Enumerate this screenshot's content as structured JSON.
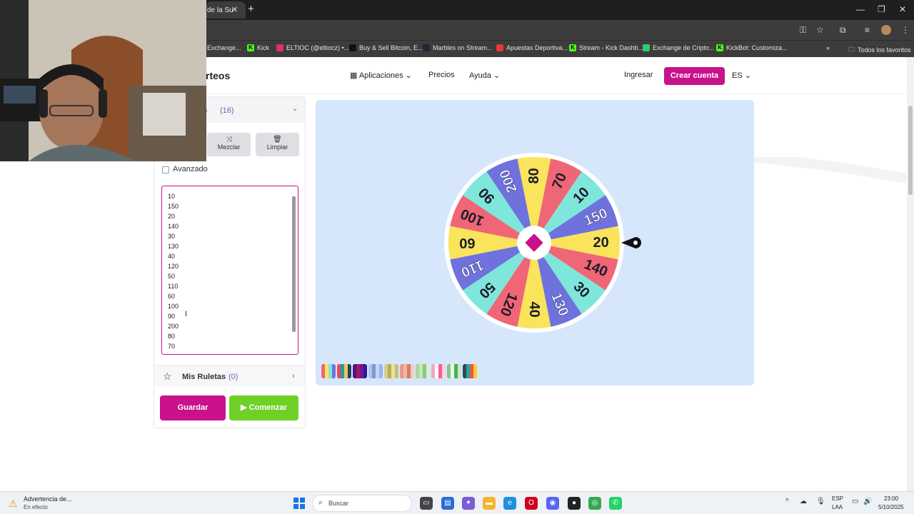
{
  "browser": {
    "active_tab_title": "de la Su",
    "bookmarks": [
      {
        "label": "Exchange...",
        "icon_color": "#ffffff"
      },
      {
        "label": "Kick",
        "icon_color": "#53fc18"
      },
      {
        "label": "ELTIOC (@eltiocz) •...",
        "icon_color": "#e1306c"
      },
      {
        "label": "Buy & Sell Bitcoin, E...",
        "icon_color": "#111111"
      },
      {
        "label": "Marbles on Stream...",
        "icon_color": "#1b2838"
      },
      {
        "label": "Apuestas Deportiva...",
        "icon_color": "#e53935"
      },
      {
        "label": "Stream - Kick Dashb...",
        "icon_color": "#53fc18"
      },
      {
        "label": "Exchange de Cripto...",
        "icon_color": "#2ecc71"
      },
      {
        "label": "KickBot: Customiza...",
        "icon_color": "#53fc18"
      }
    ],
    "all_bookmarks_label": "Todos los favoritos"
  },
  "header": {
    "logo_text": "rteos",
    "nav": {
      "apps": "Aplicaciones",
      "pricing": "Precios",
      "help": "Ayuda"
    },
    "login": "Ingresar",
    "signup": "Crear cuenta",
    "language": "ES"
  },
  "panel": {
    "entries_title": "as",
    "entries_count": "(16)",
    "shuffle_label": "Mezclar",
    "clear_label": "Limpiar",
    "advanced_label": "Avanzado",
    "advanced_checked": false,
    "entries": [
      "10",
      "150",
      "20",
      "140",
      "30",
      "130",
      "40",
      "120",
      "50",
      "110",
      "60",
      "100",
      "90",
      "200",
      "80",
      "70"
    ],
    "my_wheels_label": "Mis Ruletas",
    "my_wheels_count": "(0)",
    "save_label": "Guardar",
    "start_label": "Comenzar"
  },
  "wheel": {
    "segments": [
      "20",
      "140",
      "30",
      "130",
      "40",
      "120",
      "50",
      "110",
      "60",
      "100",
      "90",
      "200",
      "80",
      "70",
      "10",
      "150"
    ],
    "colors": [
      "#f9e45b",
      "#ef6677",
      "#7fe6dc",
      "#6f72dc"
    ],
    "pointer_value": "20"
  },
  "palette": [
    [
      "#ef6677",
      "#f9e45b",
      "#7fe6dc",
      "#6f72dc"
    ],
    [
      "#e84a5f",
      "#2a9d8f",
      "#e9c46a",
      "#264653"
    ],
    [
      "#4a148c",
      "#ad1457",
      "#6a1b9a",
      "#311b92"
    ],
    [
      "#b0c4ef",
      "#7f9ad9",
      "#c5d3f5",
      "#9fb4e6"
    ],
    [
      "#d7d08a",
      "#b8ad5a",
      "#e8e0a5",
      "#c9bf70"
    ],
    [
      "#e39a8f",
      "#f2b6a0",
      "#d47a6e",
      "#f5c9b8"
    ],
    [
      "#a8d5a2",
      "#c6e5c0",
      "#8cc784",
      "#d9efd5"
    ],
    [
      "#f4a6c1",
      "#ffffff",
      "#f06292",
      "#ffd1e1"
    ],
    [
      "#81c784",
      "#e8f5e9",
      "#4caf50",
      "#c8e6c9"
    ],
    [
      "#37474f",
      "#26a69a",
      "#ef5350",
      "#ffca28"
    ]
  ],
  "taskbar": {
    "warning_title": "Advertencia de...",
    "warning_subtitle": "En efecto",
    "search_placeholder": "Buscar",
    "lang_line1": "ESP",
    "lang_line2": "LAA",
    "time": "23:00",
    "date": "5/10/2025"
  }
}
